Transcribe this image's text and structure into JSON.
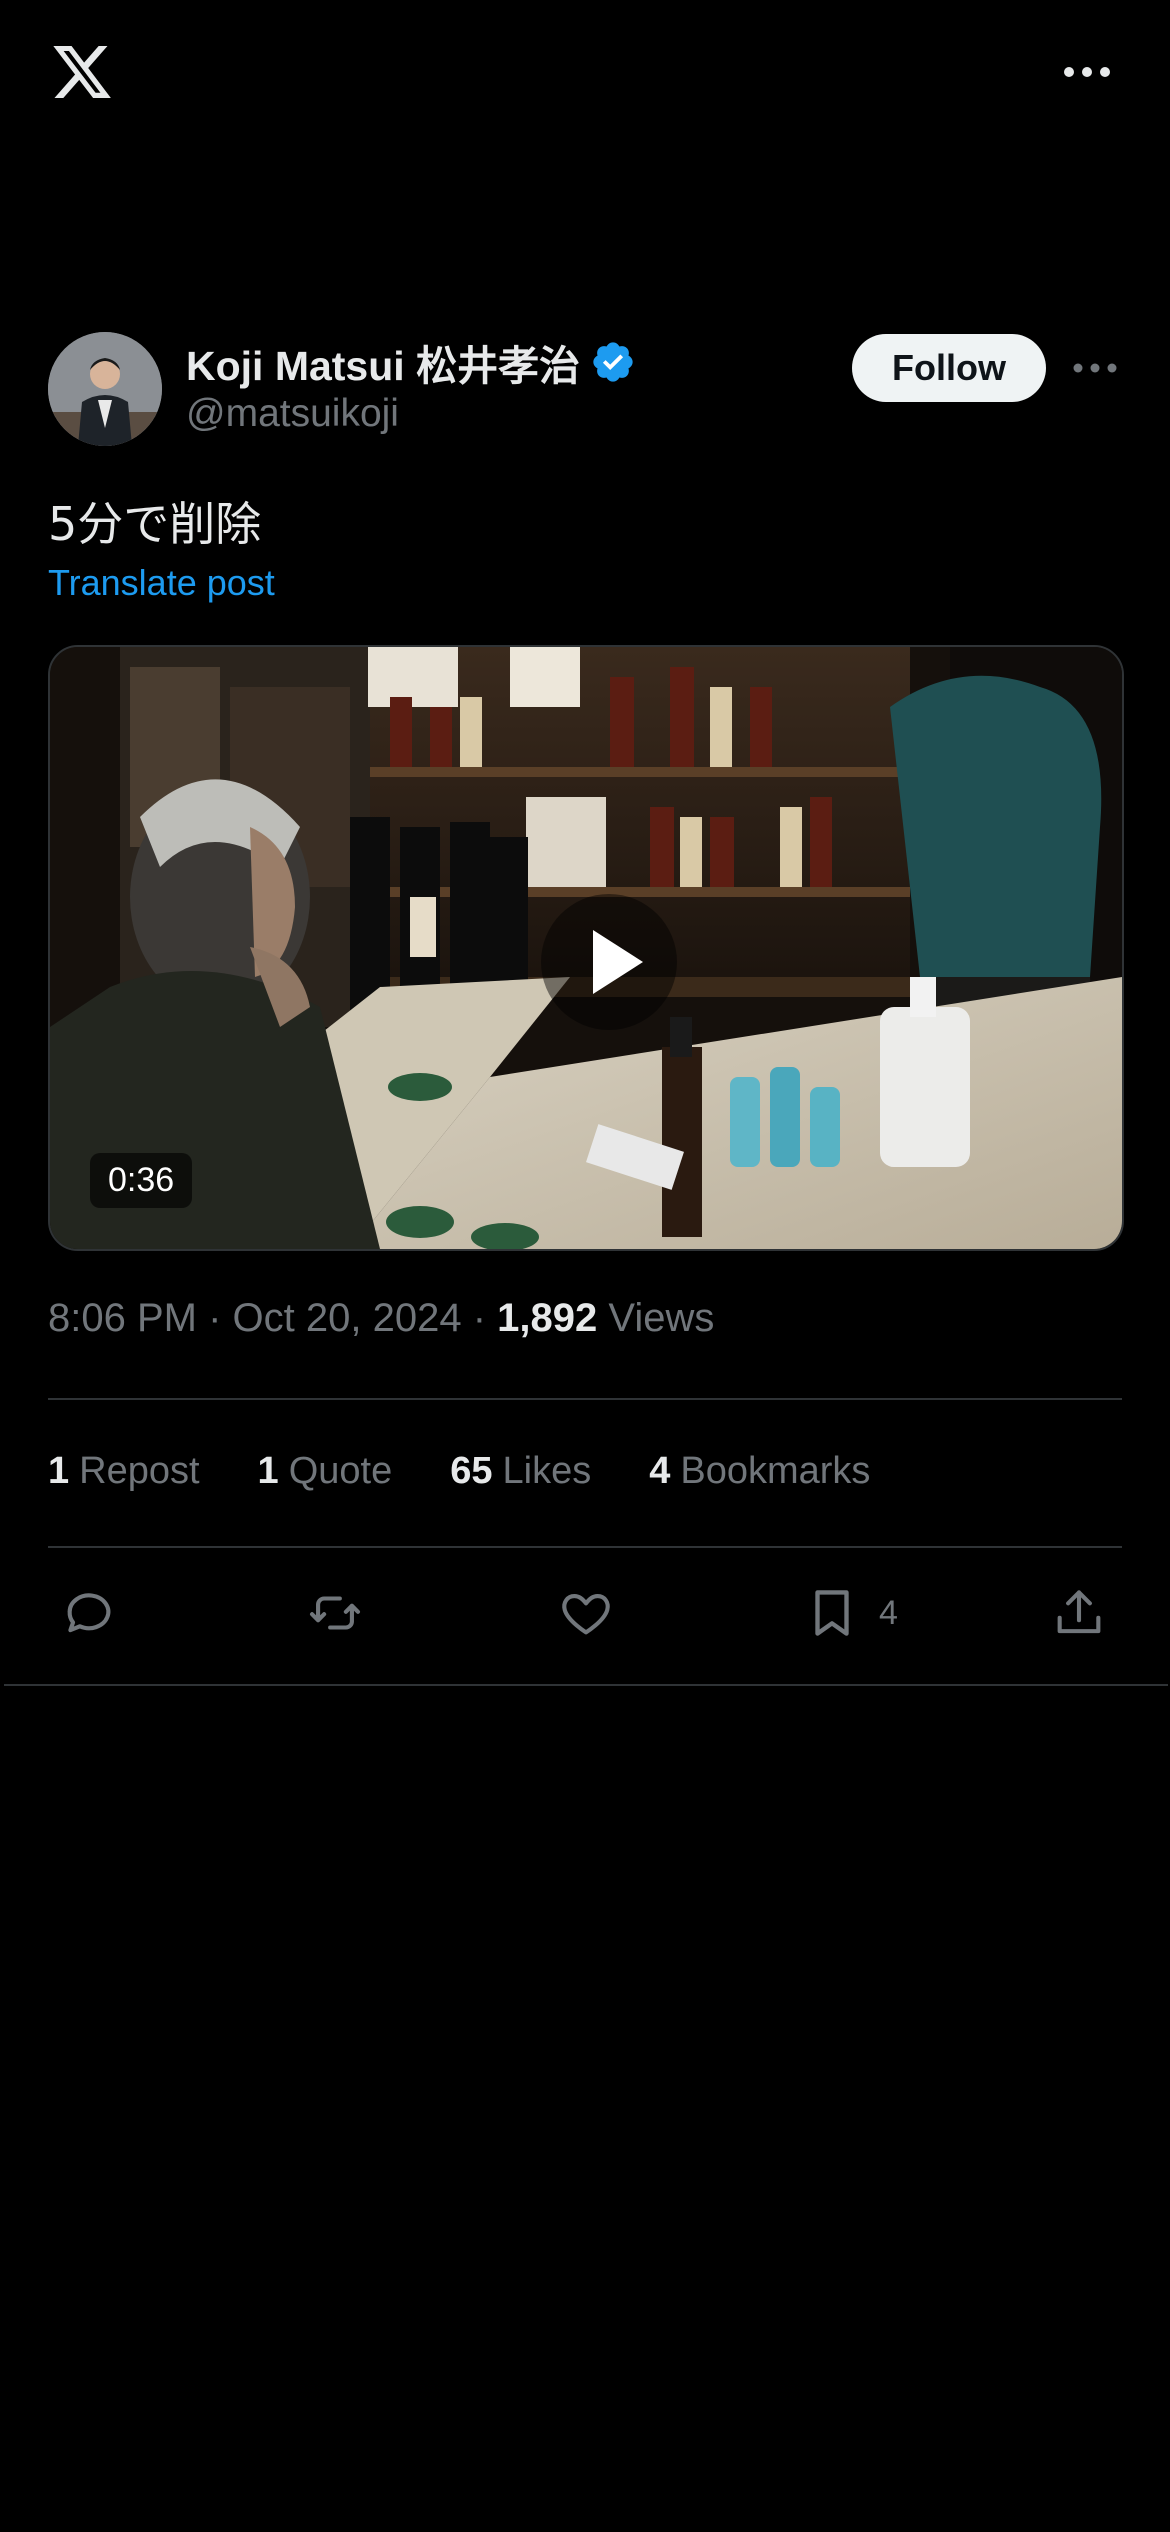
{
  "header": {
    "logo_icon": "x-logo-icon",
    "more_icon": "more-horizontal-icon"
  },
  "post": {
    "author": {
      "display_name": "Koji Matsui 松井孝治",
      "handle": "@matsuikoji",
      "verified": true,
      "follow_label": "Follow"
    },
    "text": "5分で削除",
    "translate_label": "Translate post",
    "media": {
      "type": "video",
      "duration": "0:36"
    },
    "meta": {
      "time": "8:06 PM",
      "date": "Oct 20, 2024",
      "views_count": "1,892",
      "views_label": "Views"
    },
    "stats": {
      "reposts_count": "1",
      "reposts_label": "Repost",
      "quotes_count": "1",
      "quotes_label": "Quote",
      "likes_count": "65",
      "likes_label": "Likes",
      "bookmarks_count": "4",
      "bookmarks_label": "Bookmarks"
    },
    "actions": {
      "bookmark_count": "4"
    }
  },
  "colors": {
    "accent": "#1d9bf0",
    "background": "#000000",
    "muted_text": "#71767b",
    "primary_text": "#e7e9ea",
    "divider": "#2f3336"
  }
}
